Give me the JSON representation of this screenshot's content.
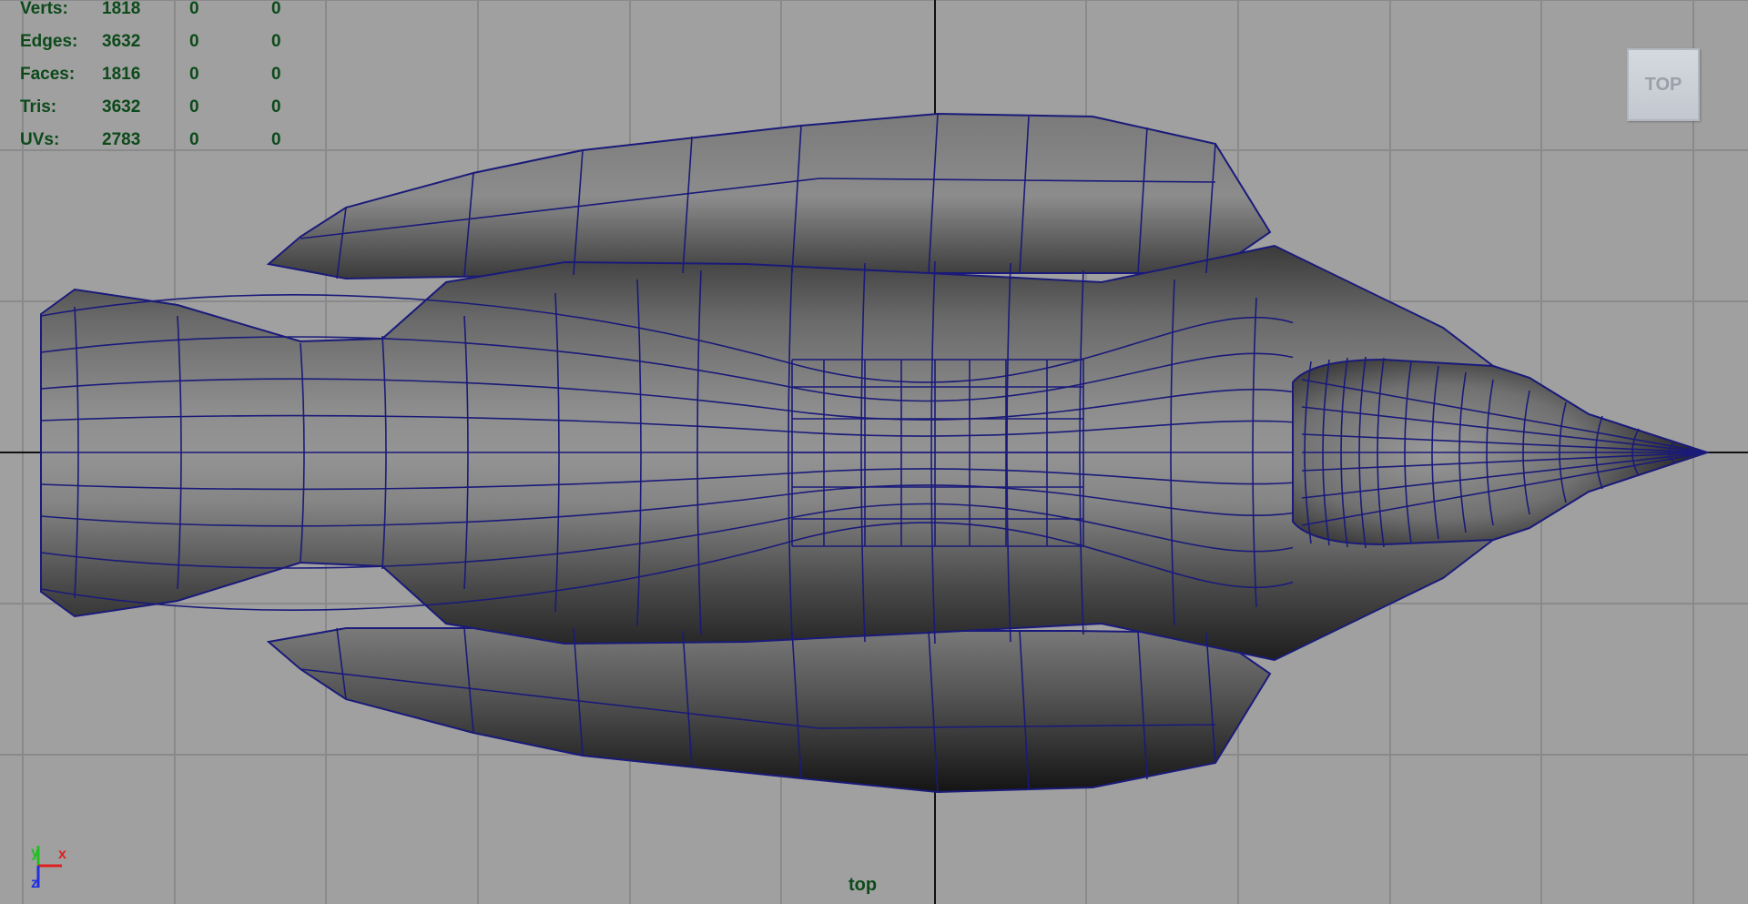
{
  "viewport": {
    "camera_name": "top",
    "view_cube_label": "TOP"
  },
  "stats": [
    {
      "label": "Verts:",
      "total": "1818",
      "selected": "0",
      "selected_uvs": "0"
    },
    {
      "label": "Edges:",
      "total": "3632",
      "selected": "0",
      "selected_uvs": "0"
    },
    {
      "label": "Faces:",
      "total": "1816",
      "selected": "0",
      "selected_uvs": "0"
    },
    {
      "label": "Tris:",
      "total": "3632",
      "selected": "0",
      "selected_uvs": "0"
    },
    {
      "label": "UVs:",
      "total": "2783",
      "selected": "0",
      "selected_uvs": "0"
    }
  ],
  "axis_gizmo": {
    "x_label": "x",
    "y_label": "y",
    "z_label": "z"
  },
  "colors": {
    "background": "#a0a0a0",
    "grid": "#8a8a8a",
    "origin_axis": "#111111",
    "wireframe": "#1a1a7a",
    "hud_text": "#0c4a1a",
    "axis_x": "#e02020",
    "axis_y": "#20c020",
    "axis_z": "#2030e0"
  }
}
